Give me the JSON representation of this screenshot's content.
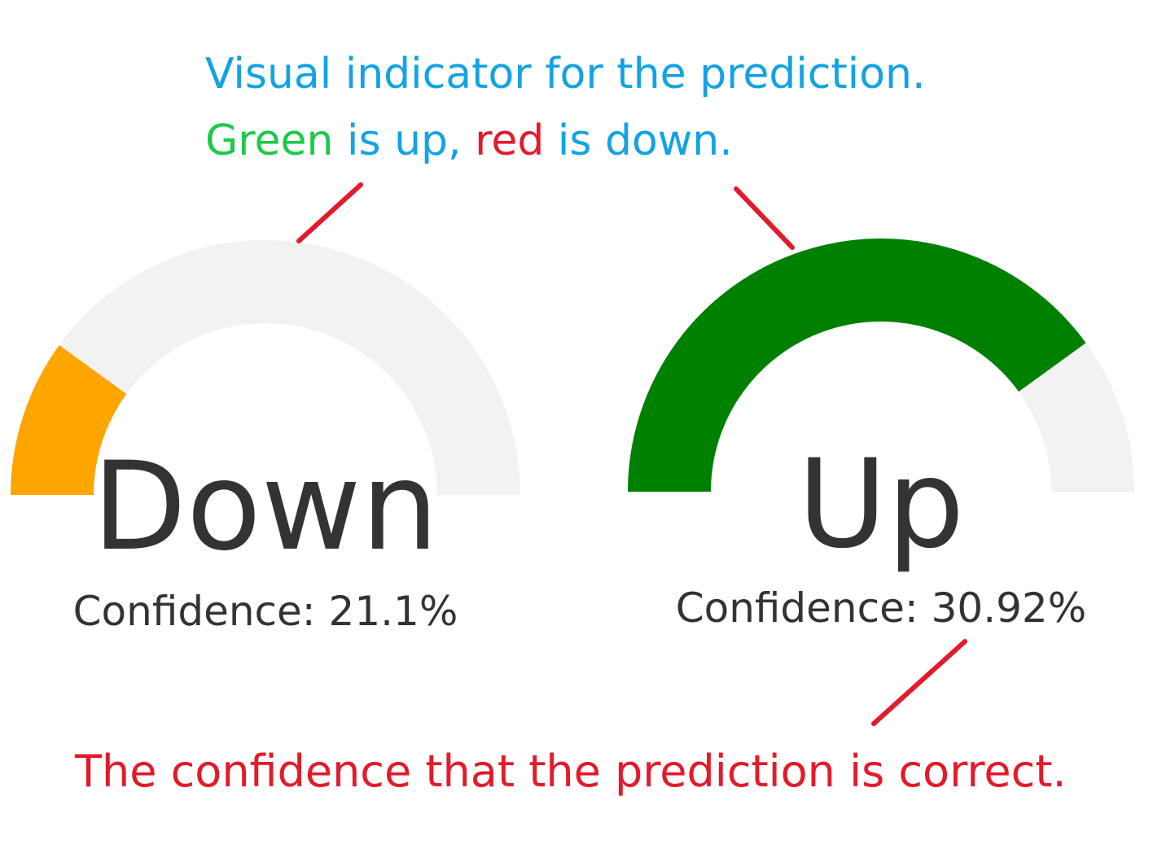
{
  "annotations": {
    "top_line1": "Visual indicator for the prediction.",
    "top_line2": {
      "green_word": "Green",
      "middle": " is up, ",
      "red_word": "red",
      "end": " is down."
    },
    "bottom": "The confidence that the prediction is correct."
  },
  "gauges": [
    {
      "label": "Down",
      "confidence_text": "Confidence: 21.1%",
      "fill_fraction": 0.2,
      "fill_color": "#ffa500",
      "track_color": "#f2f2f2"
    },
    {
      "label": "Up",
      "confidence_text": "Confidence: 30.92%",
      "fill_fraction": 0.8,
      "fill_color": "#008000",
      "track_color": "#f2f2f2"
    }
  ],
  "colors": {
    "annotation_blue": "#12a3e3",
    "annotation_green": "#1ec94a",
    "annotation_red": "#e21b2b",
    "pointer_red": "#e21b2b",
    "text_dark": "#333333"
  }
}
